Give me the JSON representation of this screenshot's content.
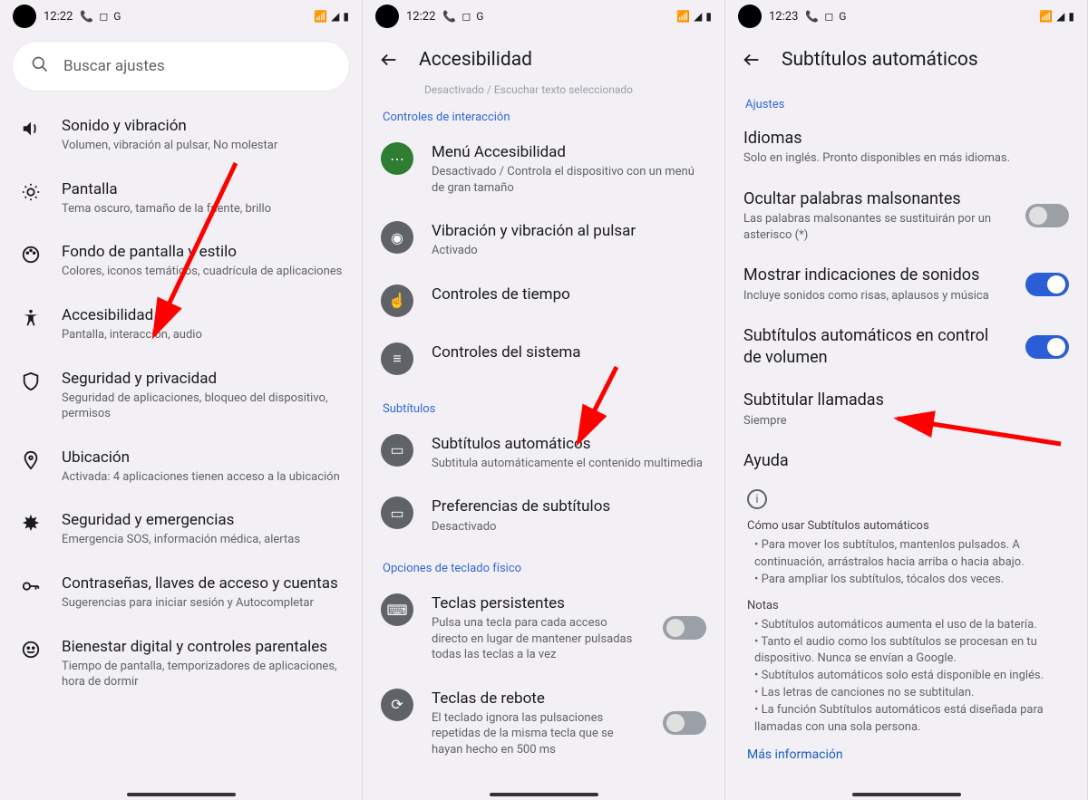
{
  "status": {
    "time_a": "12:22",
    "time_b": "12:22",
    "time_c": "12:23",
    "icons_left": "📞  ◻  G",
    "icons_right": "📶  ◢  ▮"
  },
  "phone1": {
    "search_placeholder": "Buscar ajustes",
    "items": [
      {
        "icon": "volume",
        "title": "Sonido y vibración",
        "sub": "Volumen, vibración al pulsar, No molestar"
      },
      {
        "icon": "brightness",
        "title": "Pantalla",
        "sub": "Tema oscuro, tamaño de la fuente, brillo"
      },
      {
        "icon": "palette",
        "title": "Fondo de pantalla y estilo",
        "sub": "Colores, iconos temáticos, cuadrícula de aplicaciones"
      },
      {
        "icon": "accessibility",
        "title": "Accesibilidad",
        "sub": "Pantalla, interacción, audio"
      },
      {
        "icon": "shield",
        "title": "Seguridad y privacidad",
        "sub": "Seguridad de aplicaciones, bloqueo del dispositivo, permisos"
      },
      {
        "icon": "location",
        "title": "Ubicación",
        "sub": "Activada: 4 aplicaciones tienen acceso a la ubicación"
      },
      {
        "icon": "emergency",
        "title": "Seguridad y emergencias",
        "sub": "Emergencia SOS, información médica, alertas"
      },
      {
        "icon": "key",
        "title": "Contraseñas, llaves de acceso y cuentas",
        "sub": "Sugerencias para iniciar sesión y Autocompletar"
      },
      {
        "icon": "wellbeing",
        "title": "Bienestar digital y controles parentales",
        "sub": "Tiempo de pantalla, temporizadores de aplicaciones, hora de dormir"
      }
    ]
  },
  "phone2": {
    "header": "Accesibilidad",
    "faded": "Desactivado / Escuchar texto seleccionado",
    "sec_interaction": "Controles de interacción",
    "items_interaction": [
      {
        "title": "Menú Accesibilidad",
        "sub": "Desactivado / Controla el dispositivo con un menú de gran tamaño",
        "green": true,
        "icon": "⋯"
      },
      {
        "title": "Vibración y vibración al pulsar",
        "sub": "Activado",
        "icon": "◉"
      },
      {
        "title": "Controles de tiempo",
        "sub": "",
        "icon": "☝"
      },
      {
        "title": "Controles del sistema",
        "sub": "",
        "icon": "≡"
      }
    ],
    "sec_subtitles": "Subtítulos",
    "items_subtitles": [
      {
        "title": "Subtítulos automáticos",
        "sub": "Subtitula automáticamente el contenido multimedia",
        "icon": "▭"
      },
      {
        "title": "Preferencias de subtítulos",
        "sub": "Desactivado",
        "icon": "▭"
      }
    ],
    "sec_keyboard": "Opciones de teclado físico",
    "items_keyboard": [
      {
        "title": "Teclas persistentes",
        "sub": "Pulsa una tecla para cada acceso directo en lugar de mantener pulsadas todas las teclas a la vez",
        "icon": "⌨",
        "toggle": "off"
      },
      {
        "title": "Teclas de rebote",
        "sub": "El teclado ignora las pulsaciones repetidas de la misma tecla que se hayan hecho en 500 ms",
        "icon": "⟳",
        "toggle": "off"
      }
    ]
  },
  "phone3": {
    "header": "Subtítulos automáticos",
    "sec_settings": "Ajustes",
    "items": [
      {
        "title": "Idiomas",
        "sub": "Solo en inglés. Pronto disponibles en más idiomas."
      },
      {
        "title": "Ocultar palabras malsonantes",
        "sub": "Las palabras malsonantes se sustituirán por un asterisco (*)",
        "toggle": "off"
      },
      {
        "title": "Mostrar indicaciones de sonidos",
        "sub": "Incluye sonidos como risas, aplausos y música",
        "toggle": "on"
      },
      {
        "title": "Subtítulos automáticos en control de volumen",
        "sub": "",
        "toggle": "on"
      },
      {
        "title": "Subtitular llamadas",
        "sub": "Siempre"
      },
      {
        "title": "Ayuda",
        "sub": ""
      }
    ],
    "help": {
      "heading": "Cómo usar Subtítulos automáticos",
      "bullets1": [
        "Para mover los subtítulos, mantenlos pulsados. A continuación, arrástralos hacia arriba o hacia abajo.",
        "Para ampliar los subtítulos, tócalos dos veces."
      ],
      "notes_heading": "Notas",
      "bullets2": [
        "Subtítulos automáticos aumenta el uso de la batería.",
        "Tanto el audio como los subtítulos se procesan en tu dispositivo. Nunca se envían a Google.",
        "Subtítulos automáticos solo está disponible en inglés.",
        "Las letras de canciones no se subtitulan.",
        "La función Subtítulos automáticos está diseñada para llamadas con una sola persona."
      ],
      "more": "Más información"
    }
  }
}
